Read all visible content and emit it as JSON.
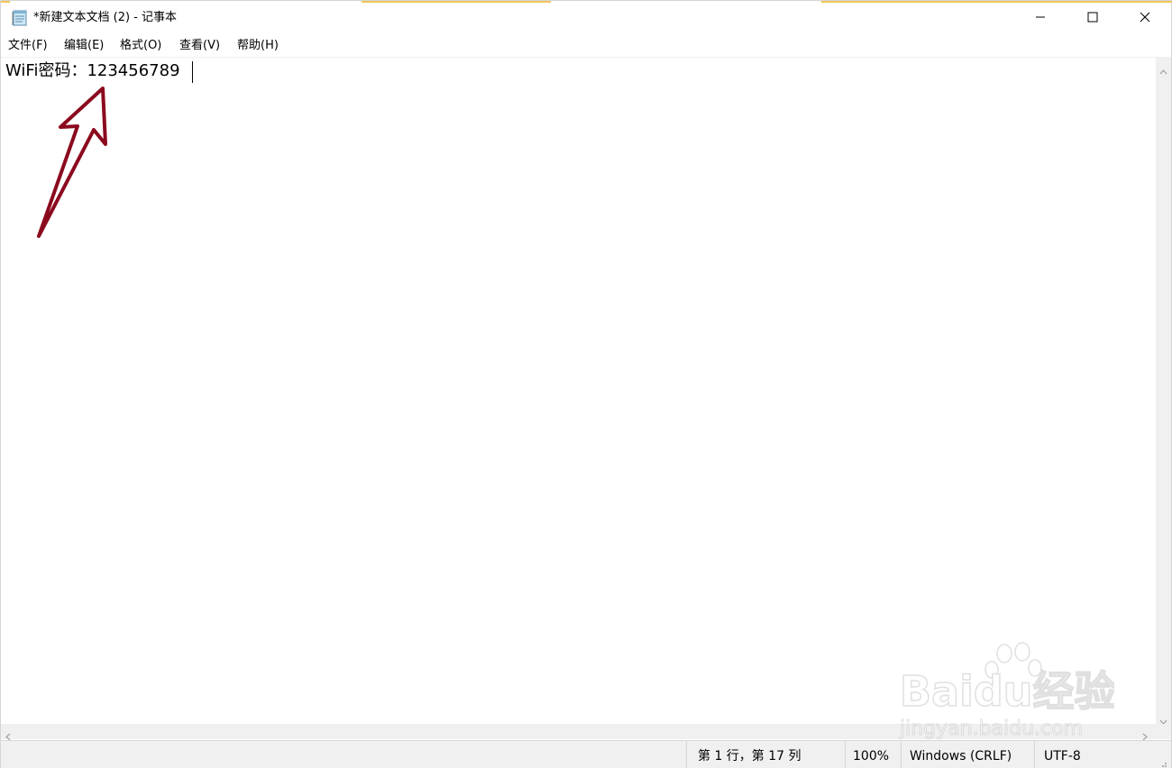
{
  "window": {
    "title": "*新建文本文档 (2) - 记事本",
    "icon": "notepad-icon",
    "controls": {
      "minimize_icon": "minimize-icon",
      "maximize_icon": "maximize-icon",
      "close_icon": "close-icon"
    }
  },
  "menubar": {
    "items": [
      {
        "label": "文件(F)"
      },
      {
        "label": "编辑(E)"
      },
      {
        "label": "格式(O)"
      },
      {
        "label": "查看(V)"
      },
      {
        "label": "帮助(H)"
      }
    ]
  },
  "editor": {
    "content": "WiFi密码：123456789"
  },
  "statusbar": {
    "position": "第 1 行，第 17 列",
    "zoom": "100%",
    "line_ending": "Windows (CRLF)",
    "encoding": "UTF-8"
  },
  "annotation": {
    "arrow_color": "#8b0a1e"
  },
  "watermark": {
    "brand_text": "Baidu经验",
    "url_text": "jingyan.baidu.com"
  }
}
